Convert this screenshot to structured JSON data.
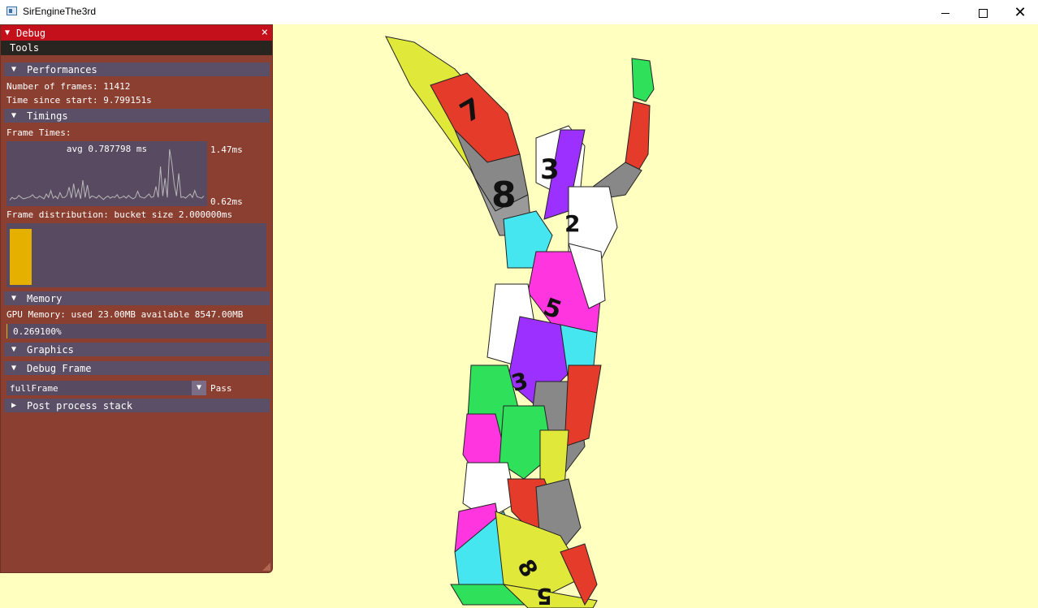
{
  "window": {
    "title": "SirEngineThe3rd",
    "minimize_glyph": "minimize-icon",
    "maximize_glyph": "maximize-icon",
    "close_glyph": "✕"
  },
  "debug": {
    "title": "Debug",
    "close": "×",
    "menu": {
      "tools": "Tools"
    },
    "performances": {
      "header": "Performances",
      "frames": "Number of frames: 11412",
      "time": "Time since start: 9.799151s"
    },
    "timings": {
      "header": "Timings",
      "frame_times_label": "Frame Times:",
      "avg": "avg 0.787798 ms",
      "max_label": "1.47ms",
      "min_label": "0.62ms",
      "distribution_label": "Frame distribution: bucket size 2.000000ms",
      "histogram_fill": 0.95
    },
    "memory": {
      "header": "Memory",
      "gpu": "GPU Memory: used 23.00MB available 8547.00MB",
      "percent_label": "0.269100%",
      "percent": 0.2691
    },
    "graphics": {
      "header": "Graphics"
    },
    "debug_frame": {
      "header": "Debug Frame",
      "selected": "fullFrame",
      "pass_label": "Pass"
    },
    "post_process": {
      "header": "Post process stack"
    }
  },
  "colors": {
    "background": "#ffffc0",
    "panel": "#8b3f30",
    "title": "#c3101a",
    "accent": "#e5b000"
  },
  "chart_data": {
    "type": "line",
    "title": "avg 0.787798 ms",
    "ylim": [
      0.62,
      1.47
    ],
    "values": [
      0.66,
      0.7,
      0.68,
      0.69,
      0.73,
      0.7,
      0.68,
      0.69,
      0.7,
      0.71,
      0.74,
      0.7,
      0.69,
      0.72,
      0.7,
      0.68,
      0.75,
      0.7,
      0.8,
      0.69,
      0.72,
      0.68,
      0.77,
      0.7,
      0.7,
      0.73,
      0.85,
      0.69,
      0.9,
      0.7,
      0.82,
      0.68,
      0.95,
      0.7,
      0.88,
      0.69,
      0.72,
      0.71,
      0.69,
      0.73,
      0.7,
      0.67,
      0.7,
      0.72,
      0.69,
      0.71,
      0.7,
      0.74,
      0.69,
      0.7,
      0.72,
      0.69,
      0.73,
      0.7,
      0.68,
      0.7,
      0.79,
      0.71,
      0.7,
      0.69,
      0.72,
      0.75,
      0.7,
      0.71,
      0.86,
      0.7,
      1.15,
      0.72,
      0.98,
      0.7,
      1.4,
      1.2,
      0.9,
      0.72,
      1.05,
      0.7,
      0.71,
      0.69,
      0.72,
      0.75,
      0.7,
      0.8,
      0.71,
      0.7,
      0.69,
      0.72
    ]
  }
}
